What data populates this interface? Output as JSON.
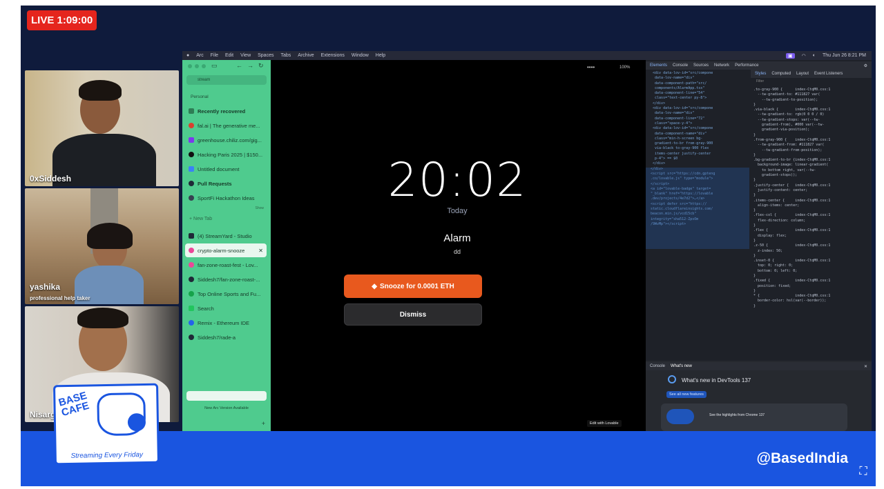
{
  "live": {
    "label": "LIVE 1:09:00"
  },
  "participants": [
    {
      "name": "0xSiddesh",
      "subtitle": ""
    },
    {
      "name": "yashika",
      "subtitle": "professional help taker"
    },
    {
      "name": "Nisarg",
      "subtitle": ""
    }
  ],
  "mac_menubar": {
    "items": [
      "Arc",
      "File",
      "Edit",
      "View",
      "Spaces",
      "Tabs",
      "Archive",
      "Extensions",
      "Window",
      "Help"
    ],
    "datetime": "Thu Jun 26 8:21 PM"
  },
  "arc_sidebar": {
    "url_text": "stream",
    "space": "Personal",
    "items": [
      {
        "label": "Recently recovered",
        "bold": true,
        "color": "#2e7d55"
      },
      {
        "label": "fal.ai | The generative me...",
        "color": "#d9412f"
      },
      {
        "label": "greenhouse.chiliz.com/gig...",
        "color": "#7c3aed"
      },
      {
        "label": "Hacking Paris 2025 | $150...",
        "color": "#111111"
      },
      {
        "label": "Untitled document",
        "color": "#3b82f6"
      },
      {
        "label": "Pull Requests",
        "bold": true,
        "color": "#1f2937"
      },
      {
        "label": "SportFi Hackathon Ideas",
        "color": "#374151"
      }
    ],
    "show_label": "Show",
    "new_tab": "+ New Tab",
    "tabs": [
      {
        "label": "(4) StreamYard - Studio",
        "color": "#1f2937"
      },
      {
        "label": "crypto-alarm-snooze",
        "active": true,
        "color": "#ec4899"
      },
      {
        "label": "fan-zone-roast-fest - Lov...",
        "color": "#ec4899"
      },
      {
        "label": "Siddesh7/fan-zone-roast-...",
        "color": "#1f2937"
      },
      {
        "label": "Top Online Sports and Fu...",
        "color": "#16a34a"
      },
      {
        "label": "Search",
        "color": "#22c55e"
      },
      {
        "label": "Remix - Ethereum IDE",
        "color": "#2563eb"
      },
      {
        "label": "Siddesh7/rade-a",
        "color": "#1f2937"
      }
    ],
    "update_notice": "New Arc Version Available"
  },
  "app": {
    "zoom": "100%",
    "time": "20:02",
    "day": "Today",
    "alarm_title": "Alarm",
    "alarm_label": "dd",
    "snooze_button": "Snooze for 0.0001 ETH",
    "dismiss_button": "Dismiss",
    "edit_badge": "Edit with Lovable"
  },
  "devtools": {
    "tabs": [
      "Elements",
      "Console",
      "Sources",
      "Network",
      "Performance"
    ],
    "styles_tabs": [
      "Styles",
      "Computed",
      "Layout",
      "Event Listeners"
    ],
    "filter_placeholder": "Filter",
    "drawer_tabs": [
      "Console",
      "What's new"
    ],
    "whats_new_title": "What's new in DevTools 137",
    "see_all": "See all new features",
    "highlight_text": "See the highlights from Chrome 137"
  },
  "branding": {
    "logo_line1": "BASE",
    "logo_line2": "CAFE",
    "logo_tagline": "Streaming Every Friday",
    "handle": "@BasedIndia"
  },
  "colors": {
    "stage_bg": "#0f1b3c",
    "band": "#1a55e0",
    "live": "#e5251d",
    "sidebar": "#4fcb8e",
    "snooze": "#e8591e"
  }
}
